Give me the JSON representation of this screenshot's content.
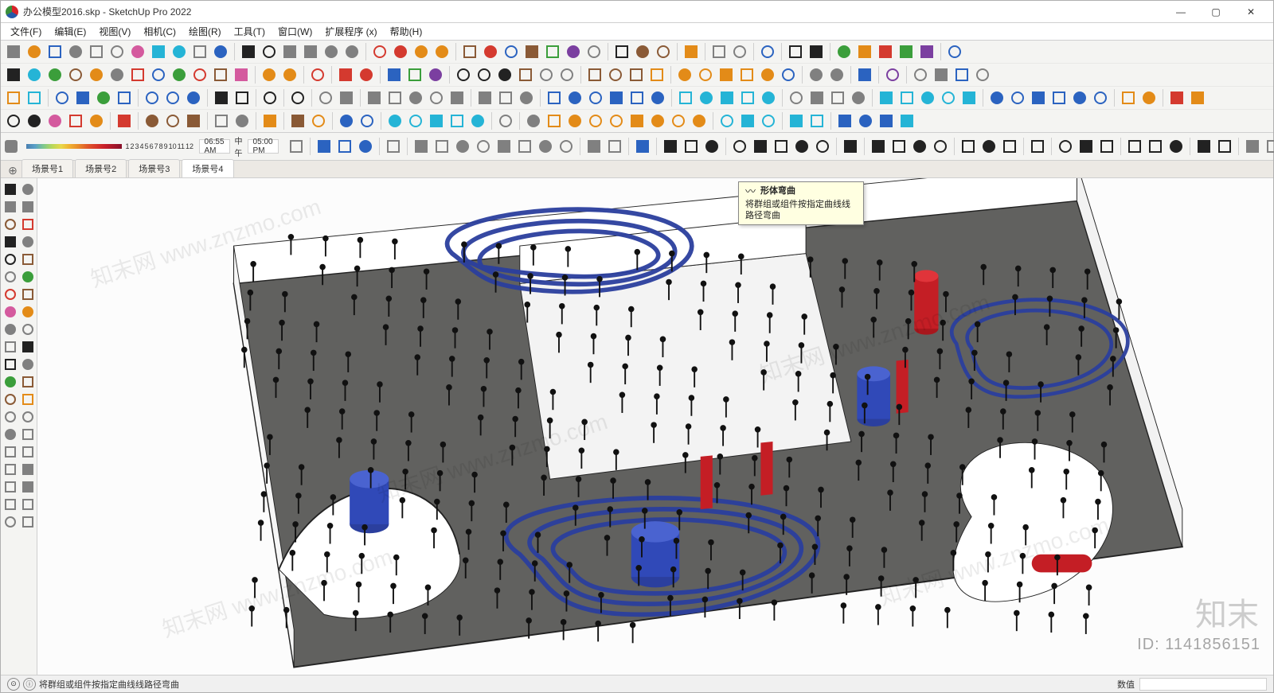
{
  "title": "办公模型2016.skp - SketchUp Pro 2022",
  "menu": [
    "文件(F)",
    "编辑(E)",
    "视图(V)",
    "相机(C)",
    "绘图(R)",
    "工具(T)",
    "窗口(W)",
    "扩展程序 (x)",
    "帮助(H)"
  ],
  "window_controls": {
    "minimize": "—",
    "maximize": "▢",
    "close": "✕"
  },
  "toolbar_rows": [
    [
      "new",
      "open",
      "save",
      "cut",
      "copy",
      "paste",
      "erase",
      "undo",
      "redo",
      "print",
      "model-info",
      "sep",
      "line",
      "freehand",
      "rect",
      "circle",
      "polygon",
      "arc",
      "sep",
      "sel-sunburst",
      "sel-red",
      "sel-add",
      "brush",
      "sep",
      "brick",
      "mat2",
      "mat3",
      "mat4",
      "mat5",
      "mat6",
      "mat7",
      "sep",
      "3d-text",
      "sandbox1",
      "sandbox2",
      "sep",
      "drape",
      "sep",
      "component",
      "group",
      "sep",
      "mirror",
      "sep",
      "axes",
      "dim",
      "sep",
      "3dwh",
      "podium",
      "vray",
      "lumion",
      "export",
      "sep",
      "gear"
    ],
    [
      "select",
      "styles",
      "orbit",
      "pushpull",
      "paint",
      "tape",
      "move",
      "rotate",
      "scale",
      "offset",
      "follow",
      "eraser",
      "sep",
      "face-make",
      "face-round",
      "sep",
      "red-group",
      "sep",
      "arrow-l",
      "arrow-r",
      "sep",
      "btn-a",
      "btn-b",
      "btn-c",
      "sep",
      "zoom",
      "zoom-ext",
      "zoom-win",
      "pan",
      "prev",
      "next",
      "sep",
      "walk",
      "look",
      "position",
      "section",
      "sep",
      "curic-1",
      "curic-2",
      "curic-3",
      "curic-4",
      "curic-5",
      "curic-6",
      "sep",
      "xray",
      "hidden",
      "sep",
      "blue-box",
      "sep",
      "purple-d",
      "sep",
      "cam",
      "outliner",
      "timer",
      "op-gear"
    ],
    [
      "enscape",
      "reload",
      "sep",
      "dark1",
      "dark2",
      "tree",
      "dark3",
      "sep",
      "check-blue",
      "cloud-up",
      "arrow-dn",
      "sep",
      "env1",
      "env2",
      "sep",
      "mail",
      "sep",
      "vray-dark",
      "sep",
      "vp1",
      "vp2",
      "sep",
      "geo1",
      "geo2",
      "geo3",
      "geo4",
      "geo5",
      "sep",
      "sphere1",
      "sphere2",
      "cursor",
      "sep",
      "vr1",
      "vr2",
      "vr3",
      "vr4",
      "vr5",
      "vr6",
      "sep",
      "teapot",
      "cup",
      "cup2",
      "cup3",
      "cup4",
      "sep",
      "layout1",
      "layout2",
      "layout3",
      "layout4",
      "sep",
      "cloud1",
      "cloud2",
      "cloud3",
      "cloud4",
      "cloud5",
      "sep",
      "cb1",
      "cb2",
      "cb3",
      "cb4",
      "cb5",
      "cb6",
      "sep",
      "dl1",
      "dl2",
      "sep",
      "dl-red",
      "dl-gear"
    ],
    [
      "zoom2",
      "select2",
      "eraser2",
      "pencil",
      "crayon",
      "sep",
      "line-red",
      "sep",
      "s1",
      "s2",
      "s3",
      "sep",
      "sel-sq",
      "textbox",
      "sep",
      "paintbrush",
      "sep",
      "brush2",
      "hand",
      "sep",
      "mag1",
      "mag2",
      "sep",
      "water1",
      "water2",
      "water3",
      "water4",
      "water5",
      "sep",
      "user",
      "sep",
      "tray",
      "sun1",
      "sun2",
      "sun3",
      "angle",
      "sun4",
      "sunset",
      "dome",
      "clock",
      "sep",
      "layers1",
      "layers2",
      "gear2",
      "sep",
      "globe1",
      "globe2",
      "sep",
      "box-bl",
      "grid",
      "grid2",
      "cloud-x"
    ]
  ],
  "shadow_bar": {
    "palette_numbers": [
      "1",
      "2",
      "3",
      "4",
      "5",
      "6",
      "7",
      "8",
      "9",
      "10",
      "11",
      "12"
    ],
    "time1": "06:55 AM",
    "mid_label": "中午",
    "time2": "05:00 PM"
  },
  "bottom_tool_row": [
    "shade",
    "sep",
    "cube1",
    "cube2",
    "cube3",
    "sep",
    "proj",
    "sep",
    "m1",
    "m2",
    "m3",
    "m4",
    "m5",
    "m6",
    "m7",
    "m8",
    "sep",
    "gt1",
    "gt2",
    "sep",
    "bar-graph",
    "sep",
    "line-a",
    "line-b",
    "line-c",
    "sep",
    "curve-a",
    "curve-b",
    "curve-c",
    "curve-d",
    "curve-e",
    "sep",
    "xx",
    "sep",
    "path1",
    "path2",
    "path3",
    "path4",
    "sep",
    "bird",
    "star",
    "dot",
    "sep",
    "bend-shape",
    "sep",
    "smooth1",
    "smooth2",
    "smooth3",
    "sep",
    "tilde1",
    "dot2",
    "tilde2",
    "sep",
    "sp1",
    "sp2",
    "sep",
    "tx-a",
    "tx-b",
    "tx-c",
    "sep",
    "txt-A",
    "txt-T",
    "sep",
    "split"
  ],
  "scene_tabs": {
    "items": [
      "场景号1",
      "场景号2",
      "场景号3",
      "场景号4"
    ],
    "active": 3
  },
  "left_toolbar_pairs": [
    [
      "select",
      "3dbox"
    ],
    [
      "rect",
      "circle"
    ],
    [
      "pushpull",
      "move"
    ],
    [
      "line",
      "arc"
    ],
    [
      "zoom",
      "pan"
    ],
    [
      "rot",
      "scale"
    ],
    [
      "offset",
      "follow"
    ],
    [
      "erase",
      "paint"
    ],
    [
      "tape",
      "prot"
    ],
    [
      "text",
      "dim"
    ],
    [
      "axes",
      "3dtext"
    ],
    [
      "orbit",
      "walk"
    ],
    [
      "look",
      "section"
    ],
    [
      "prev",
      "next"
    ],
    [
      "zoomext",
      "zoomwin"
    ],
    [
      "iso",
      "top"
    ],
    [
      "front",
      "right"
    ],
    [
      "bulb",
      "sun"
    ],
    [
      "geo",
      "layer"
    ],
    [
      "water",
      "more"
    ]
  ],
  "tooltip": {
    "title": "形体弯曲",
    "body": "将群组或组件按指定曲线线路径弯曲"
  },
  "status": {
    "left_icon1": "⊙",
    "left_icon2": "ⓘ",
    "text": "将群组或组件按指定曲线线路径弯曲",
    "right_label": "数值",
    "right_value": ""
  },
  "watermark": {
    "logo_text": "知末",
    "url": "知末网 www.znzmo.com",
    "id_label": "ID: 1141856151"
  },
  "tool_colors": {
    "default": "c-gray",
    "new": "c-gray",
    "open": "c-orange",
    "save": "c-blue",
    "cut": "c-gray",
    "copy": "c-gray",
    "paste": "c-gray",
    "erase": "c-pink",
    "undo": "c-cyan",
    "redo": "c-cyan",
    "print": "c-gray",
    "model-info": "c-blue",
    "line": "c-black",
    "freehand": "c-black",
    "rect": "c-gray",
    "circle": "c-gray",
    "polygon": "c-gray",
    "arc": "c-gray",
    "sel-sunburst": "c-red",
    "sel-red": "c-red",
    "sel-add": "c-orange",
    "brush": "c-orange",
    "brick": "c-brown",
    "mat2": "c-red",
    "mat3": "c-blue",
    "mat4": "c-brown",
    "mat5": "c-green",
    "mat6": "c-purple",
    "mat7": "c-gray",
    "3d-text": "c-black",
    "sandbox1": "c-brown",
    "sandbox2": "c-brown",
    "drape": "c-orange",
    "component": "c-gray",
    "group": "c-gray",
    "mirror": "c-blue",
    "axes": "c-black",
    "dim": "c-black",
    "3dwh": "c-green",
    "podium": "c-orange",
    "vray": "c-red",
    "lumion": "c-green",
    "export": "c-purple",
    "gear": "c-blue",
    "select": "c-black",
    "styles": "c-cyan",
    "orbit": "c-green",
    "pushpull": "c-brown",
    "paint": "c-orange",
    "tape": "c-gray",
    "move": "c-red",
    "rotate": "c-blue",
    "scale": "c-green",
    "offset": "c-red",
    "follow": "c-brown",
    "eraser": "c-pink",
    "face-make": "c-orange",
    "face-round": "c-orange",
    "red-group": "c-red",
    "arrow-l": "c-red",
    "arrow-r": "c-red",
    "btn-a": "c-blue",
    "btn-b": "c-green",
    "btn-c": "c-purple",
    "zoom": "c-black",
    "zoom-ext": "c-black",
    "zoom-win": "c-black",
    "pan": "c-brown",
    "prev": "c-gray",
    "next": "c-gray",
    "walk": "c-brown",
    "look": "c-brown",
    "position": "c-brown",
    "section": "c-orange",
    "curic-1": "c-orange",
    "curic-2": "c-orange",
    "curic-3": "c-orange",
    "curic-4": "c-orange",
    "curic-5": "c-orange",
    "curic-6": "c-blue",
    "xray": "c-gray",
    "hidden": "c-gray",
    "blue-box": "c-blue",
    "purple-d": "c-purple",
    "cam": "c-gray",
    "outliner": "c-gray",
    "timer": "c-blue",
    "op-gear": "c-gray",
    "enscape": "c-orange",
    "reload": "c-cyan",
    "dark1": "c-blue",
    "dark2": "c-blue",
    "tree": "c-green",
    "dark3": "c-blue",
    "check-blue": "c-blue",
    "cloud-up": "c-blue",
    "arrow-dn": "c-blue",
    "env1": "c-black",
    "env2": "c-black",
    "mail": "c-black",
    "vray-dark": "c-black",
    "vp1": "c-gray",
    "vp2": "c-gray",
    "geo1": "c-gray",
    "geo2": "c-gray",
    "geo3": "c-gray",
    "geo4": "c-gray",
    "geo5": "c-gray",
    "sphere1": "c-gray",
    "sphere2": "c-gray",
    "cursor": "c-gray",
    "vr1": "c-blue",
    "vr2": "c-blue",
    "vr3": "c-blue",
    "vr4": "c-blue",
    "vr5": "c-blue",
    "vr6": "c-blue",
    "teapot": "c-cyan",
    "cup": "c-cyan",
    "cup2": "c-cyan",
    "cup3": "c-cyan",
    "cup4": "c-cyan",
    "layout1": "c-gray",
    "layout2": "c-gray",
    "layout3": "c-gray",
    "layout4": "c-gray",
    "cloud1": "c-cyan",
    "cloud2": "c-cyan",
    "cloud3": "c-cyan",
    "cloud4": "c-cyan",
    "cloud5": "c-cyan",
    "cb1": "c-blue",
    "cb2": "c-blue",
    "cb3": "c-blue",
    "cb4": "c-blue",
    "cb5": "c-blue",
    "cb6": "c-blue",
    "dl1": "c-orange",
    "dl2": "c-orange",
    "dl-red": "c-red",
    "dl-gear": "c-orange",
    "zoom2": "c-black",
    "select2": "c-black",
    "eraser2": "c-pink",
    "pencil": "c-red",
    "crayon": "c-orange",
    "line-red": "c-red",
    "s1": "c-brown",
    "s2": "c-brown",
    "s3": "c-brown",
    "sel-sq": "c-gray",
    "textbox": "c-gray",
    "paintbrush": "c-orange",
    "brush2": "c-brown",
    "hand": "c-orange",
    "mag1": "c-blue",
    "mag2": "c-blue",
    "water1": "c-cyan",
    "water2": "c-cyan",
    "water3": "c-cyan",
    "water4": "c-cyan",
    "water5": "c-cyan",
    "user": "c-gray",
    "tray": "c-gray",
    "sun1": "c-orange",
    "sun2": "c-orange",
    "sun3": "c-orange",
    "angle": "c-orange",
    "sun4": "c-orange",
    "sunset": "c-orange",
    "dome": "c-orange",
    "clock": "c-orange",
    "layers1": "c-cyan",
    "layers2": "c-cyan",
    "gear2": "c-cyan",
    "globe1": "c-cyan",
    "globe2": "c-cyan",
    "box-bl": "c-blue",
    "grid": "c-blue",
    "grid2": "c-blue",
    "cloud-x": "c-cyan",
    "shade": "c-gray",
    "cube1": "c-blue",
    "cube2": "c-blue",
    "cube3": "c-blue",
    "proj": "c-gray",
    "m1": "c-gray",
    "m2": "c-gray",
    "m3": "c-gray",
    "m4": "c-gray",
    "m5": "c-gray",
    "m6": "c-gray",
    "m7": "c-gray",
    "m8": "c-gray",
    "gt1": "c-gray",
    "gt2": "c-gray",
    "bar-graph": "c-blue",
    "line-a": "c-black",
    "line-b": "c-black",
    "line-c": "c-black",
    "curve-a": "c-black",
    "curve-b": "c-black",
    "curve-c": "c-black",
    "curve-d": "c-black",
    "curve-e": "c-black",
    "xx": "c-black",
    "path1": "c-black",
    "path2": "c-black",
    "path3": "c-black",
    "path4": "c-black",
    "bird": "c-black",
    "star": "c-black",
    "dot": "c-black",
    "bend-shape": "c-black",
    "smooth1": "c-black",
    "smooth2": "c-black",
    "smooth3": "c-black",
    "tilde1": "c-black",
    "dot2": "c-black",
    "tilde2": "c-black",
    "sp1": "c-black",
    "sp2": "c-black",
    "tx-a": "c-gray",
    "tx-b": "c-gray",
    "tx-c": "c-gray",
    "txt-A": "c-black",
    "txt-T": "c-black",
    "split": "c-gray"
  }
}
